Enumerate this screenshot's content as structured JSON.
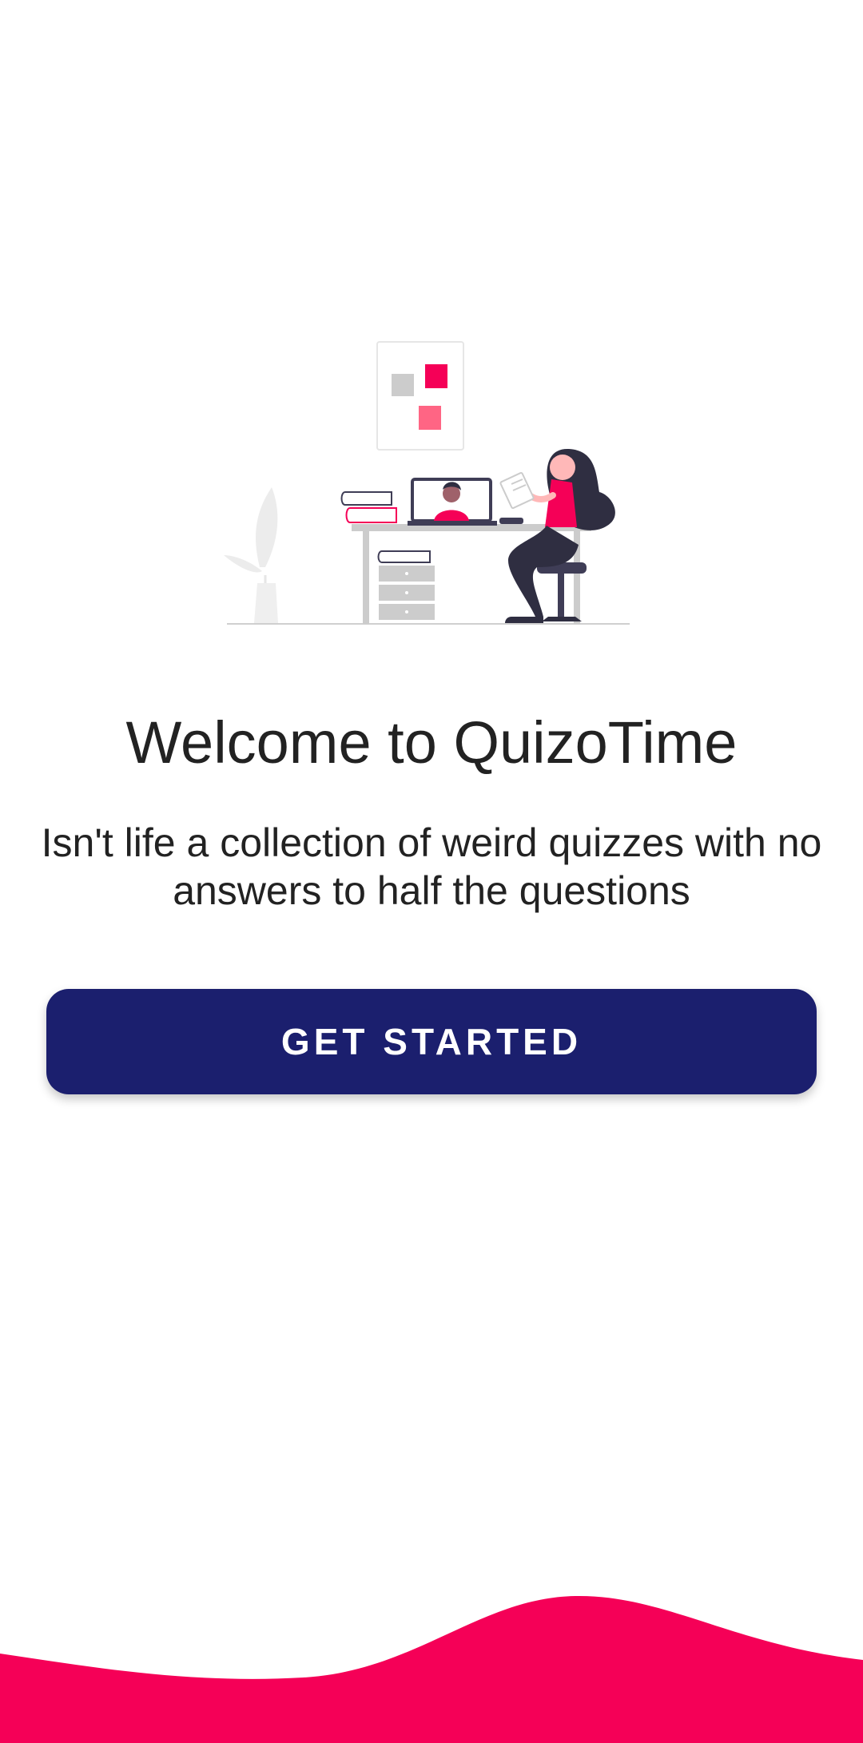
{
  "welcome": {
    "title": "Welcome to QuizoTime",
    "subtitle": "Isn't life a collection of weird quizzes with no answers to half the questions",
    "cta_label": "GET STARTED"
  },
  "illustration": {
    "name": "person-at-desk-illustration"
  },
  "colors": {
    "primary_button": "#1b1f6e",
    "accent": "#f50057",
    "accent_light": "#ff6584",
    "background": "#ffffff",
    "text": "#222222"
  }
}
